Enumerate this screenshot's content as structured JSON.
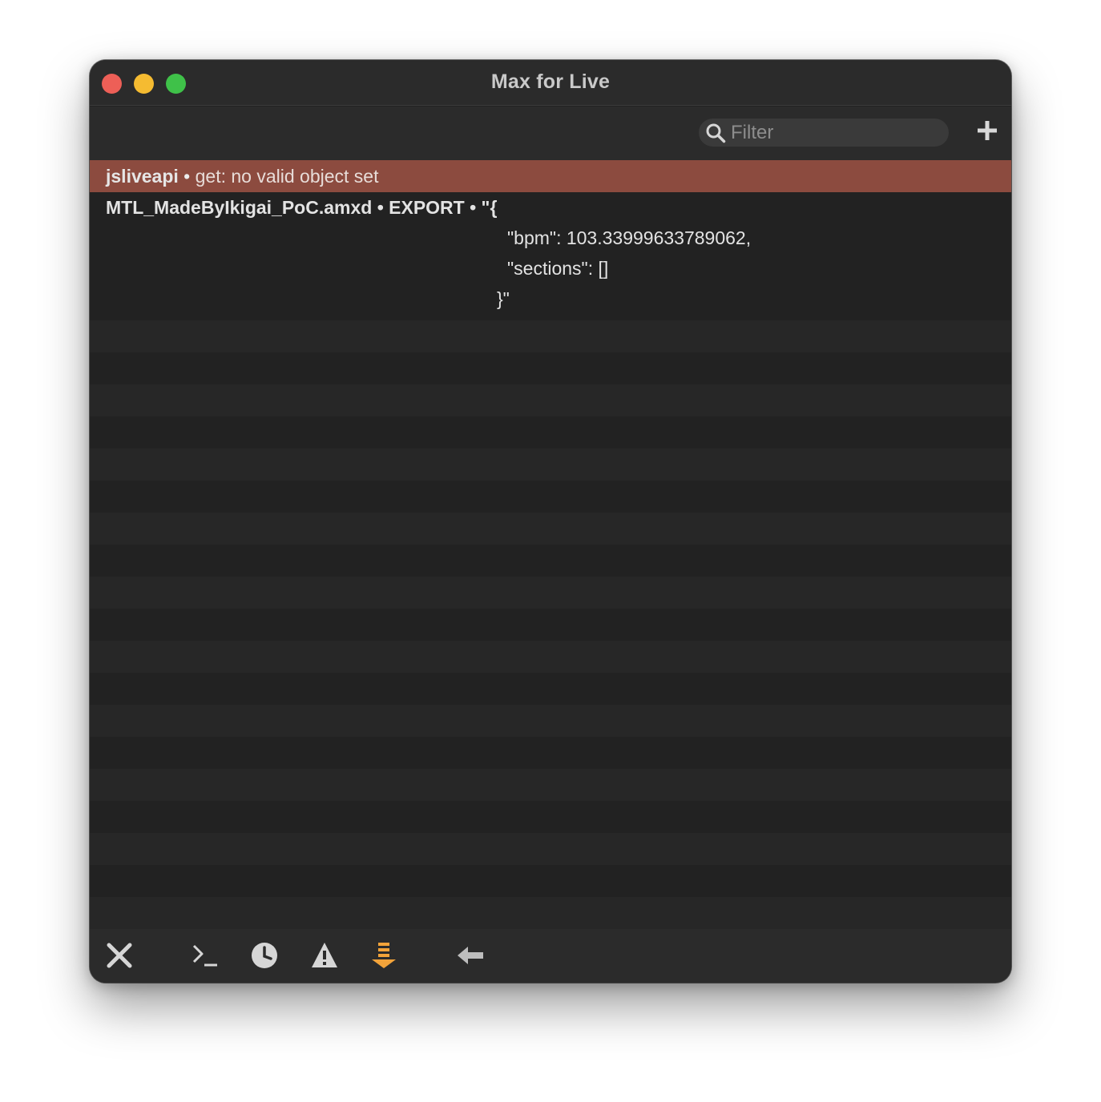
{
  "window": {
    "title": "Max for Live"
  },
  "toolbar": {
    "filter_placeholder": "Filter",
    "add_icon": "plus-icon"
  },
  "console": {
    "error_row": {
      "source": "jsliveapi",
      "separator": " • ",
      "message": "get: no valid object set"
    },
    "message_row": {
      "header": "MTL_MadeByIkigai_PoC.amxd • EXPORT • \"{",
      "lines": [
        "\"bpm\": 103.33999633789062,",
        "\"sections\": []",
        "}\""
      ]
    }
  },
  "bottom_toolbar": {
    "icons": [
      "clear-icon",
      "command-prompt-icon",
      "clock-icon",
      "warning-icon",
      "scroll-down-icon",
      "arrow-left-icon"
    ]
  },
  "colors": {
    "window_bg": "#222222",
    "titlebar_bg": "#2b2b2b",
    "error_row_bg": "#8c4b3f",
    "accent_orange": "#f2a33a",
    "icon_gray": "#d0d0d0"
  }
}
